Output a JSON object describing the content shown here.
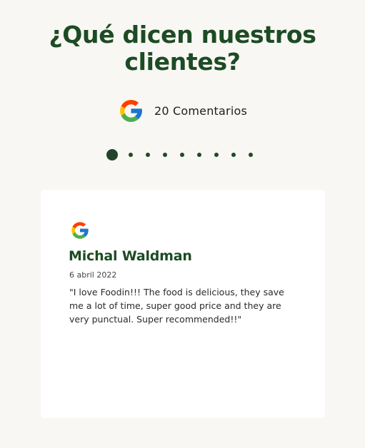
{
  "section": {
    "title": "¿Qué dicen nuestros clientes?"
  },
  "summary": {
    "icon": "google-icon",
    "count_label": "20 Comentarios"
  },
  "carousel": {
    "dot_count": 9,
    "active_index": 0
  },
  "review": {
    "source_icon": "google-icon",
    "author": "Michal Waldman",
    "date": "6 abril 2022",
    "text": "\"I love Foodin!!! The food is delicious, they save me a lot of time, super good price and they are very punctual. Super recommended!!\""
  },
  "colors": {
    "background": "#f8f7f3",
    "accent_green": "#1d4b24",
    "card": "#ffffff"
  }
}
